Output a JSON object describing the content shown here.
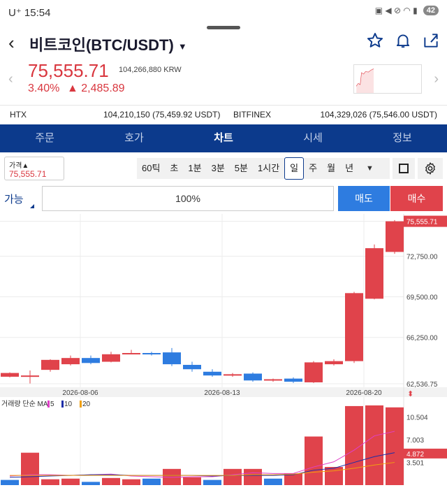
{
  "status": {
    "carrier": "U⁺ 15:54",
    "battery": "42"
  },
  "header": {
    "title": "비트코인(BTC/USDT)"
  },
  "price": {
    "main": "75,555.71",
    "krw": "104,266,880 KRW",
    "pct": "3.40%",
    "change": "▲ 2,485.89"
  },
  "exchanges": [
    {
      "name": "HTX",
      "value": "104,210,150 (75,459.92 USDT)"
    },
    {
      "name": "BITFINEX",
      "value": "104,329,026 (75,546.00 USDT)"
    }
  ],
  "tabs": [
    "주문",
    "호가",
    "차트",
    "시세",
    "정보"
  ],
  "active_tab": "차트",
  "toolbar": {
    "price_label": "가격▲",
    "price_value": "75,555.71",
    "periods": [
      "60틱",
      "초",
      "1분",
      "3분",
      "5분",
      "1시간",
      "일",
      "주",
      "월",
      "년"
    ],
    "selected_period": "일"
  },
  "order": {
    "available_label": "가능",
    "percent": "100%",
    "sell": "매도",
    "buy": "매수"
  },
  "colors": {
    "up": "#e0434b",
    "down": "#2e7ce0",
    "brand": "#0c3a8c"
  },
  "chart_data": [
    {
      "type": "candlestick",
      "x_ticks": [
        "2026-08-06",
        "2026-08-13",
        "2026-08-20"
      ],
      "y_ticks": [
        62536.75,
        66250.0,
        69500.0,
        72750.0,
        75555.71
      ],
      "y_tick_labels": [
        "62,536.75",
        "66,250.00",
        "69,500.00",
        "72,750.00",
        "75,555.71"
      ],
      "current_price_label": "75,555.71",
      "ylim": [
        62536.75,
        75700
      ],
      "candles": [
        {
          "o": 63100,
          "c": 63400,
          "h": 63450,
          "l": 63050
        },
        {
          "o": 63100,
          "c": 63200,
          "h": 63600,
          "l": 62560
        },
        {
          "o": 63650,
          "c": 64450,
          "h": 64500,
          "l": 63500
        },
        {
          "o": 64100,
          "c": 64600,
          "h": 64800,
          "l": 64000
        },
        {
          "o": 64600,
          "c": 64200,
          "h": 64800,
          "l": 64100
        },
        {
          "o": 64300,
          "c": 64900,
          "h": 65100,
          "l": 64250
        },
        {
          "o": 64900,
          "c": 65000,
          "h": 65250,
          "l": 64900
        },
        {
          "o": 65000,
          "c": 64950,
          "h": 65100,
          "l": 64800
        },
        {
          "o": 65050,
          "c": 64100,
          "h": 65400,
          "l": 63950
        },
        {
          "o": 64050,
          "c": 63700,
          "h": 64300,
          "l": 63500
        },
        {
          "o": 63500,
          "c": 63200,
          "h": 63700,
          "l": 63100
        },
        {
          "o": 63200,
          "c": 63300,
          "h": 63400,
          "l": 63100
        },
        {
          "o": 63350,
          "c": 62800,
          "h": 63450,
          "l": 62700
        },
        {
          "o": 62800,
          "c": 62900,
          "h": 62950,
          "l": 62700
        },
        {
          "o": 62950,
          "c": 62700,
          "h": 63050,
          "l": 62600
        },
        {
          "o": 62650,
          "c": 64250,
          "h": 64350,
          "l": 62600
        },
        {
          "o": 64100,
          "c": 64350,
          "h": 64500,
          "l": 64000
        },
        {
          "o": 64350,
          "c": 69800,
          "h": 69900,
          "l": 64200
        },
        {
          "o": 69350,
          "c": 73400,
          "h": 73700,
          "l": 69300
        },
        {
          "o": 73100,
          "c": 75555.71,
          "h": 75650,
          "l": 72950
        }
      ]
    },
    {
      "type": "bar",
      "legend_title": "거래량 단순 MA",
      "legend": [
        "5",
        "10",
        "20"
      ],
      "ma_colors": [
        "#e040c8",
        "#1d2ea8",
        "#f0a010"
      ],
      "y_tick_labels": [
        "10.504",
        "7.003",
        "3.501"
      ],
      "y_ticks": [
        10.504,
        7.003,
        3.501
      ],
      "current_label": "4.872",
      "ylim": [
        0,
        12.3
      ],
      "values": [
        0.8,
        5.0,
        0.9,
        1.0,
        0.5,
        1.1,
        0.9,
        1.0,
        2.5,
        1.2,
        0.8,
        2.5,
        2.5,
        1.0,
        1.8,
        7.5,
        2.8,
        12.2,
        12.3,
        12.0
      ],
      "up": [
        false,
        true,
        true,
        true,
        false,
        true,
        true,
        false,
        true,
        true,
        false,
        true,
        true,
        false,
        true,
        true,
        true,
        true,
        true,
        true
      ],
      "ma5": [
        1.4,
        1.6,
        1.6,
        1.5,
        1.6,
        1.7,
        1.4,
        1.3,
        1.2,
        1.3,
        1.3,
        1.6,
        1.9,
        1.8,
        1.8,
        2.8,
        3.6,
        5.4,
        7.6,
        8.3
      ],
      "ma10": [
        1.2,
        1.3,
        1.4,
        1.5,
        1.6,
        1.6,
        1.5,
        1.5,
        1.5,
        1.5,
        1.4,
        1.5,
        1.5,
        1.5,
        1.6,
        2.3,
        2.6,
        3.5,
        4.4,
        5.0
      ],
      "ma20": [
        1.5,
        1.5,
        1.5,
        1.5,
        1.5,
        1.5,
        1.5,
        1.5,
        1.5,
        1.5,
        1.5,
        1.5,
        1.6,
        1.6,
        1.7,
        2.0,
        2.2,
        2.6,
        3.1,
        3.5
      ]
    }
  ]
}
